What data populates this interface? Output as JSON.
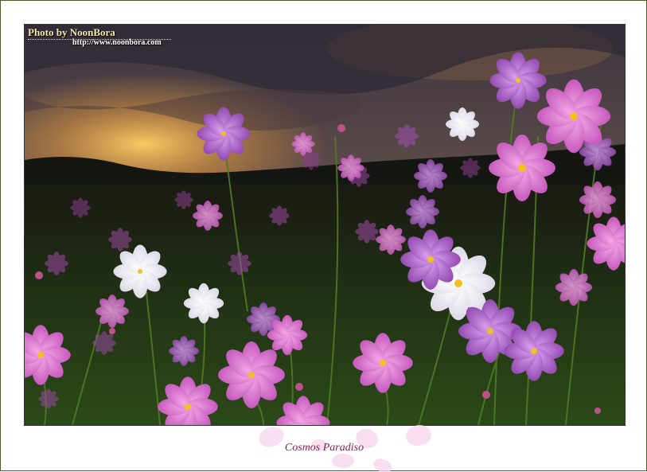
{
  "watermark": {
    "title": "Photo by NoonBora",
    "url": "http://www.noonbora.com"
  },
  "caption": "Cosmos Paradiso",
  "colors": {
    "frame_border": "#4a5a2a",
    "caption": "#8a1f5c",
    "watermark_title": "#f3e9a6"
  },
  "photo": {
    "subject": "cosmos-flower-field-at-sunset"
  }
}
